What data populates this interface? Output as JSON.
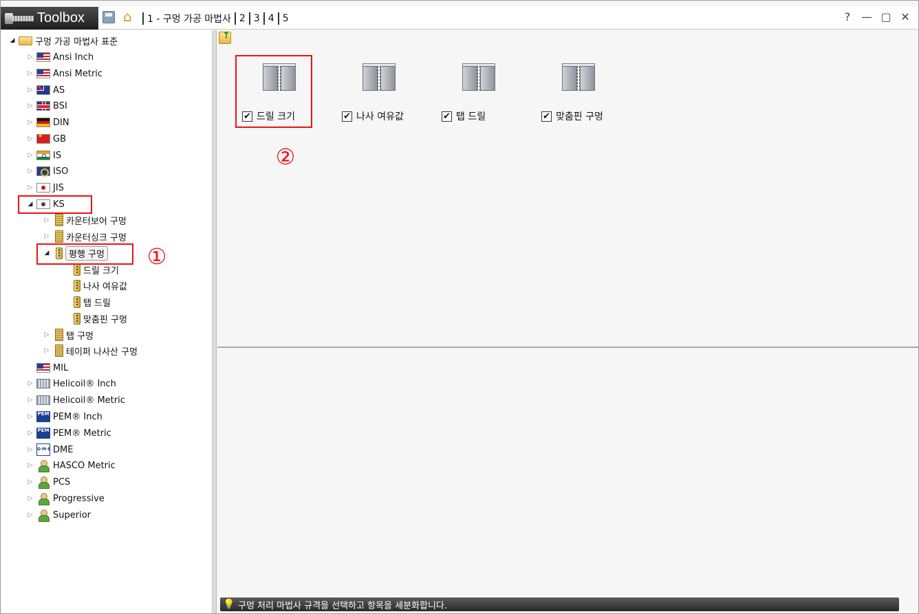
{
  "titlebar": {
    "app_title": "Toolbox",
    "breadcrumbs": [
      "1 - 구멍 가공 마법사",
      "2",
      "3",
      "4",
      "5"
    ],
    "window_buttons": [
      "?",
      "—",
      "▢",
      "✕"
    ]
  },
  "tree": {
    "root_label": "구멍 가공 마법사 표준",
    "standards": [
      {
        "label": "Ansi Inch",
        "icon": "us-flag-icon"
      },
      {
        "label": "Ansi Metric",
        "icon": "us-flag-icon"
      },
      {
        "label": "AS",
        "icon": "australia-flag-icon"
      },
      {
        "label": "BSI",
        "icon": "uk-flag-icon"
      },
      {
        "label": "DIN",
        "icon": "germany-flag-icon"
      },
      {
        "label": "GB",
        "icon": "china-flag-icon"
      },
      {
        "label": "IS",
        "icon": "india-flag-icon"
      },
      {
        "label": "ISO",
        "icon": "iso-flag-icon"
      },
      {
        "label": "JIS",
        "icon": "japan-flag-icon"
      },
      {
        "label": "KS",
        "icon": "korea-flag-icon"
      }
    ],
    "ks_children": [
      "카운터보어 구멍",
      "카운터싱크 구멍",
      "평행 구멍",
      "탭 구멍",
      "테이퍼 나사산 구멍"
    ],
    "parallel_children": [
      "드릴 크기",
      "나사 여유값",
      "탭 드릴",
      "맞춤핀 구멍"
    ],
    "others": [
      {
        "label": "MIL",
        "icon": "us-flag-icon"
      },
      {
        "label": "Helicoil® Inch",
        "icon": "helicoil-icon"
      },
      {
        "label": "Helicoil® Metric",
        "icon": "helicoil-icon"
      },
      {
        "label": "PEM® Inch",
        "icon": "pem-icon"
      },
      {
        "label": "PEM® Metric",
        "icon": "pem-icon"
      },
      {
        "label": "DME",
        "icon": "dme-icon"
      },
      {
        "label": "HASCO Metric",
        "icon": "person-icon"
      },
      {
        "label": "PCS",
        "icon": "person-icon"
      },
      {
        "label": "Progressive",
        "icon": "person-icon"
      },
      {
        "label": "Superior",
        "icon": "person-icon"
      }
    ],
    "icon_text": {
      "pem": "PEM",
      "dme": "D·M·E"
    }
  },
  "annotations": {
    "step1": "①",
    "step2": "②"
  },
  "categories": [
    {
      "label": "드릴 크기",
      "checked": true
    },
    {
      "label": "나사 여유값",
      "checked": true
    },
    {
      "label": "탭 드릴",
      "checked": true
    },
    {
      "label": "맞춤핀 구멍",
      "checked": true
    }
  ],
  "checkmark": "✔",
  "status": {
    "text": "구멍 처리 마법사 규격을 선택하고 항목을 세분화합니다."
  },
  "colors": {
    "highlight": "#e11111",
    "statusbar": "#2a2a2a"
  }
}
